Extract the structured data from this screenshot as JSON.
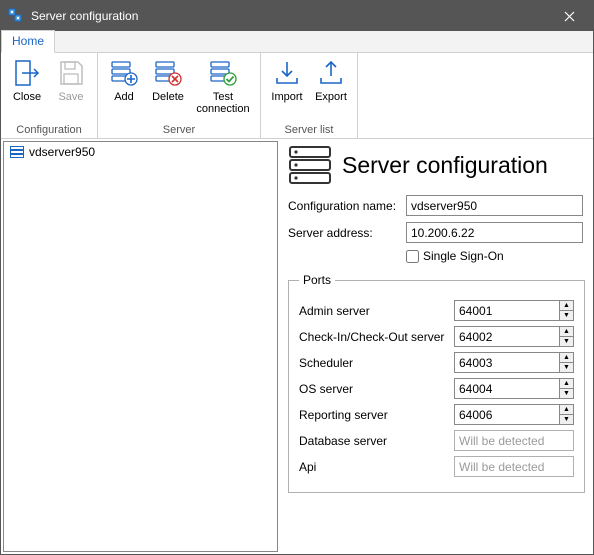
{
  "window": {
    "title": "Server configuration"
  },
  "tabs": {
    "home": "Home"
  },
  "ribbon": {
    "close": "Close",
    "save": "Save",
    "add": "Add",
    "delete": "Delete",
    "test": "Test connection",
    "import": "Import",
    "export": "Export",
    "group_configuration": "Configuration",
    "group_server": "Server",
    "group_serverlist": "Server list"
  },
  "tree": {
    "items": [
      {
        "label": "vdserver950"
      }
    ]
  },
  "panel": {
    "heading": "Server configuration",
    "config_name_label": "Configuration name:",
    "config_name_value": "vdserver950",
    "server_address_label": "Server address:",
    "server_address_value": "10.200.6.22",
    "sso_label": "Single Sign-On",
    "ports_legend": "Ports",
    "ports": {
      "admin_label": "Admin server",
      "admin_value": "64001",
      "cico_label": "Check-In/Check-Out server",
      "cico_value": "64002",
      "scheduler_label": "Scheduler",
      "scheduler_value": "64003",
      "os_label": "OS server",
      "os_value": "64004",
      "reporting_label": "Reporting server",
      "reporting_value": "64006",
      "database_label": "Database server",
      "database_placeholder": "Will be detected",
      "api_label": "Api",
      "api_placeholder": "Will be detected"
    }
  }
}
